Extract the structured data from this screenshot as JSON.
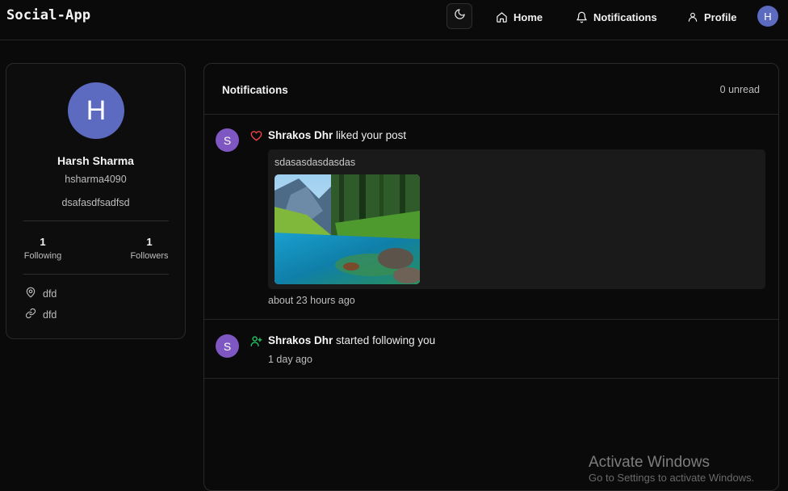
{
  "nav": {
    "brand": "Social-App",
    "home_label": "Home",
    "notifications_label": "Notifications",
    "profile_label": "Profile",
    "avatar_initial": "H"
  },
  "profile": {
    "avatar_initial": "H",
    "name": "Harsh Sharma",
    "username": "hsharma4090",
    "bio": "dsafasdfsadfsd",
    "following_count": "1",
    "following_label": "Following",
    "followers_count": "1",
    "followers_label": "Followers",
    "location": "dfd",
    "website": "dfd"
  },
  "notifications": {
    "title": "Notifications",
    "unread": "0 unread",
    "items": [
      {
        "avatar_initial": "S",
        "user": "Shrakos Dhr",
        "action": "liked your post",
        "type": "like",
        "post_text": "sdasasdasdasdas",
        "time": "about 23 hours ago"
      },
      {
        "avatar_initial": "S",
        "user": "Shrakos Dhr",
        "action": "started following you",
        "type": "follow",
        "time": "1 day ago"
      }
    ]
  },
  "overlay": {
    "watermark": "Activate Windows",
    "watermark_sub": "Go to Settings to activate Windows."
  },
  "colors": {
    "avatar_user": "#5c6bc0",
    "avatar_other": "#7e57c2",
    "like_icon": "#ef4444",
    "follow_icon": "#22c55e"
  }
}
